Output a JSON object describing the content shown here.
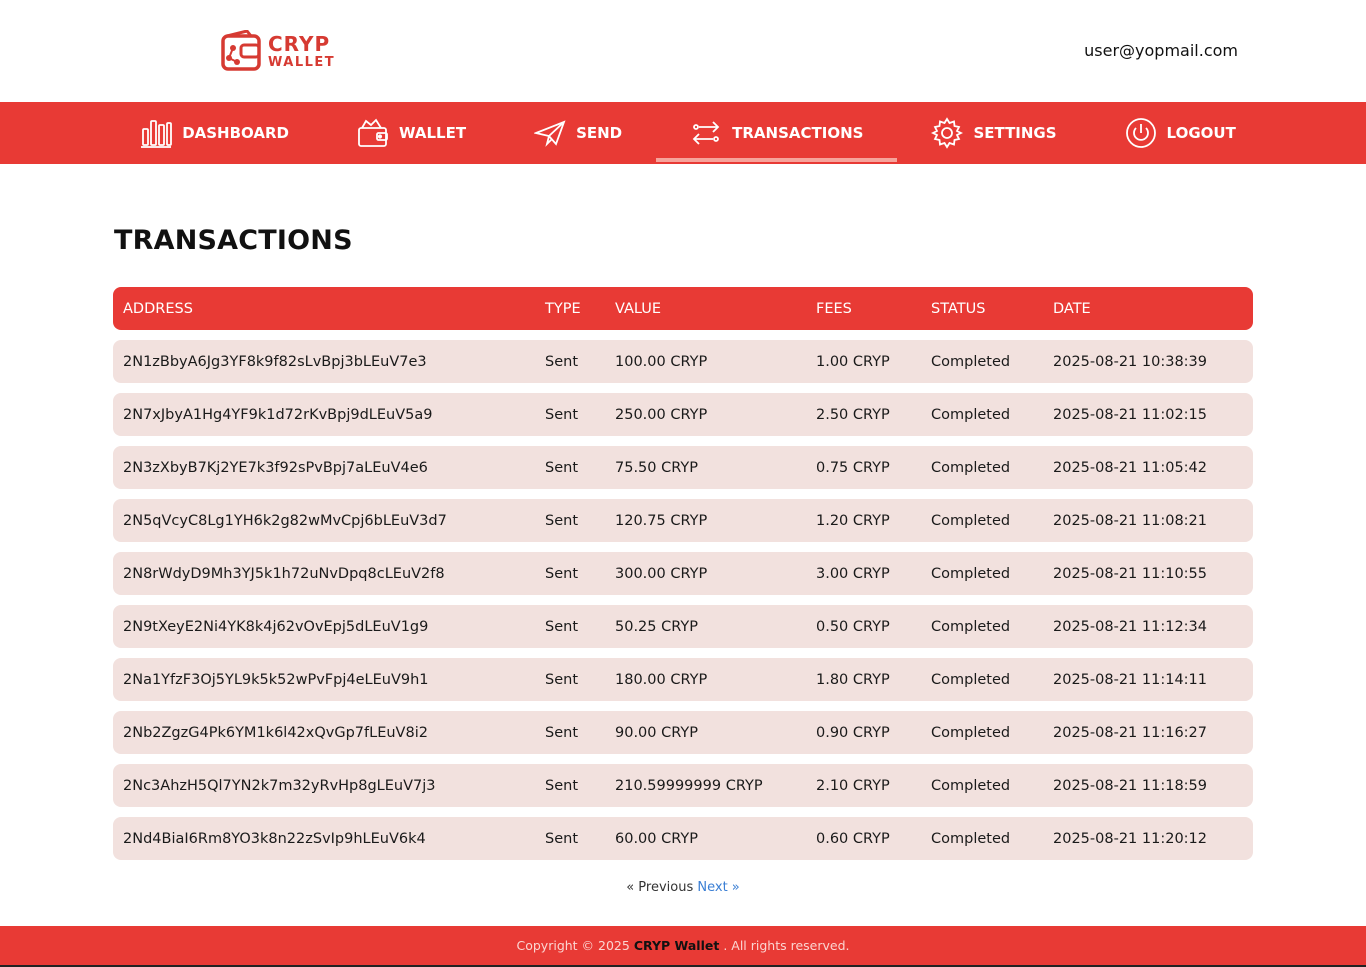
{
  "brand": {
    "line1": "CRYP",
    "line2": "WALLET",
    "color": "#d63a32"
  },
  "user": {
    "email": "user@yopmail.com"
  },
  "nav": {
    "items": [
      {
        "label": "DASHBOARD",
        "icon": "bar-chart-icon"
      },
      {
        "label": "WALLET",
        "icon": "wallet-icon"
      },
      {
        "label": "SEND",
        "icon": "paper-plane-icon"
      },
      {
        "label": "TRANSACTIONS",
        "icon": "arrows-exchange-icon",
        "active": true
      },
      {
        "label": "SETTINGS",
        "icon": "gear-icon"
      },
      {
        "label": "LOGOUT",
        "icon": "power-icon"
      }
    ],
    "color": "#e83a35"
  },
  "page": {
    "title": "TRANSACTIONS"
  },
  "table": {
    "headers": {
      "address": "ADDRESS",
      "type": "TYPE",
      "value": "VALUE",
      "fees": "FEES",
      "status": "STATUS",
      "date": "DATE"
    },
    "rows": [
      {
        "address": "2N1zBbyA6Jg3YF8k9f82sLvBpj3bLEuV7e3",
        "type": "Sent",
        "value": "100.00 CRYP",
        "fees": "1.00 CRYP",
        "status": "Completed",
        "date": "2025-08-21 10:38:39"
      },
      {
        "address": "2N7xJbyA1Hg4YF9k1d72rKvBpj9dLEuV5a9",
        "type": "Sent",
        "value": "250.00 CRYP",
        "fees": "2.50 CRYP",
        "status": "Completed",
        "date": "2025-08-21 11:02:15"
      },
      {
        "address": "2N3zXbyB7Kj2YE7k3f92sPvBpj7aLEuV4e6",
        "type": "Sent",
        "value": "75.50 CRYP",
        "fees": "0.75 CRYP",
        "status": "Completed",
        "date": "2025-08-21 11:05:42"
      },
      {
        "address": "2N5qVcyC8Lg1YH6k2g82wMvCpj6bLEuV3d7",
        "type": "Sent",
        "value": "120.75 CRYP",
        "fees": "1.20 CRYP",
        "status": "Completed",
        "date": "2025-08-21 11:08:21"
      },
      {
        "address": "2N8rWdyD9Mh3YJ5k1h72uNvDpq8cLEuV2f8",
        "type": "Sent",
        "value": "300.00 CRYP",
        "fees": "3.00 CRYP",
        "status": "Completed",
        "date": "2025-08-21 11:10:55"
      },
      {
        "address": "2N9tXeyE2Ni4YK8k4j62vOvEpj5dLEuV1g9",
        "type": "Sent",
        "value": "50.25 CRYP",
        "fees": "0.50 CRYP",
        "status": "Completed",
        "date": "2025-08-21 11:12:34"
      },
      {
        "address": "2Na1YfzF3Oj5YL9k5k52wPvFpj4eLEuV9h1",
        "type": "Sent",
        "value": "180.00 CRYP",
        "fees": "1.80 CRYP",
        "status": "Completed",
        "date": "2025-08-21 11:14:11"
      },
      {
        "address": "2Nb2ZgzG4Pk6YM1k6l42xQvGp7fLEuV8i2",
        "type": "Sent",
        "value": "90.00 CRYP",
        "fees": "0.90 CRYP",
        "status": "Completed",
        "date": "2025-08-21 11:16:27"
      },
      {
        "address": "2Nc3AhzH5Ql7YN2k7m32yRvHp8gLEuV7j3",
        "type": "Sent",
        "value": "210.59999999 CRYP",
        "fees": "2.10 CRYP",
        "status": "Completed",
        "date": "2025-08-21 11:18:59"
      },
      {
        "address": "2Nd4BiaI6Rm8YO3k8n22zSvIp9hLEuV6k4",
        "type": "Sent",
        "value": "60.00 CRYP",
        "fees": "0.60 CRYP",
        "status": "Completed",
        "date": "2025-08-21 11:20:12"
      }
    ],
    "row_color": "#f2e1de"
  },
  "pagination": {
    "previous": "« Previous",
    "next": "Next »"
  },
  "footer": {
    "prefix": "Copyright © 2025",
    "brand": "CRYP Wallet",
    "suffix": ". All rights reserved."
  }
}
